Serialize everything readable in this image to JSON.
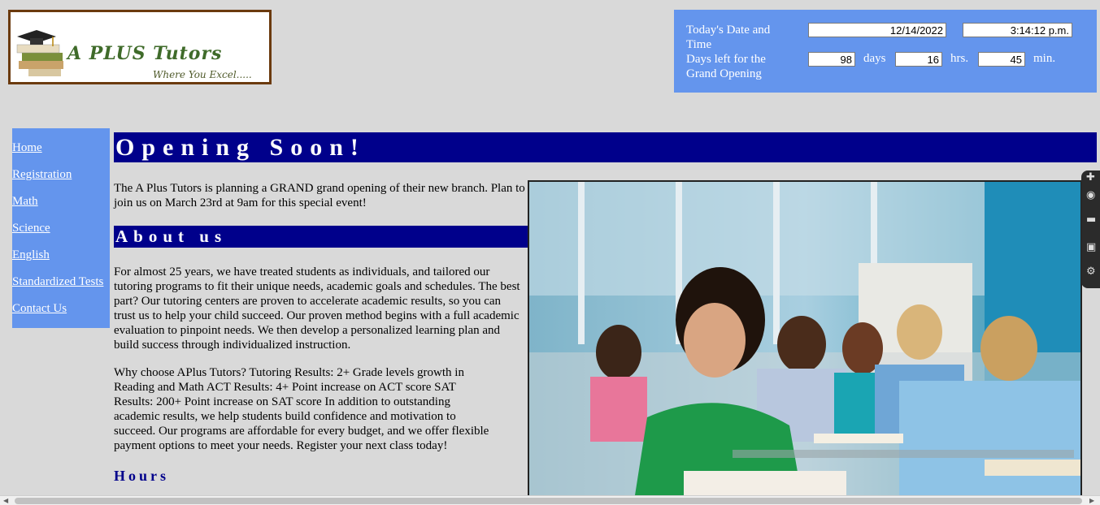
{
  "logo": {
    "title": "A PLUS Tutors",
    "tagline": "Where You Excel.....",
    "border_color": "#6b3a0e"
  },
  "clock": {
    "date_label": "Today's Date and Time",
    "countdown_label": "Days left for the Grand Opening",
    "date_value": "12/14/2022",
    "time_value": "3:14:12 p.m.",
    "days_value": "98",
    "days_unit": "days",
    "hours_value": "16",
    "hours_unit": "hrs.",
    "minutes_value": "45",
    "minutes_unit": "min.",
    "background": "#6495ed"
  },
  "nav": {
    "items": [
      {
        "label": "Home"
      },
      {
        "label": "Registration"
      },
      {
        "label": "Math"
      },
      {
        "label": "Science"
      },
      {
        "label": "English"
      },
      {
        "label": "Standardized Tests"
      },
      {
        "label": "Contact Us"
      }
    ]
  },
  "main": {
    "heading": "Opening Soon!",
    "intro": "The A Plus Tutors is planning a GRAND grand opening of their new branch. Plan to join us on March 23rd at 9am for this special event!",
    "about_heading": "About us",
    "about_p1": "For almost 25 years, we have treated students as individuals, and tailored our tutoring programs to fit their unique needs, academic goals and schedules. The best part? Our tutoring centers are proven to accelerate academic results, so you can trust us to help your child succeed. Our proven method begins with a full academic evaluation to pinpoint needs. We then develop a personalized learning plan and build success through individualized instruction.",
    "about_p2": "Why choose APlus Tutors? Tutoring Results: 2+ Grade levels growth in Reading and Math ACT Results: 4+ Point increase on ACT score SAT Results: 200+ Point increase on SAT score In addition to outstanding academic results, we help students build confidence and motivation to succeed. Our programs are affordable for every budget, and we offer flexible payment options to meet your needs. Register your next class today!",
    "hours_heading": "Hours",
    "heading_color": "#00008b"
  },
  "toolbar_icons": [
    "pin-icon",
    "camera-icon",
    "folder-icon",
    "gallery-icon",
    "gear-icon"
  ]
}
